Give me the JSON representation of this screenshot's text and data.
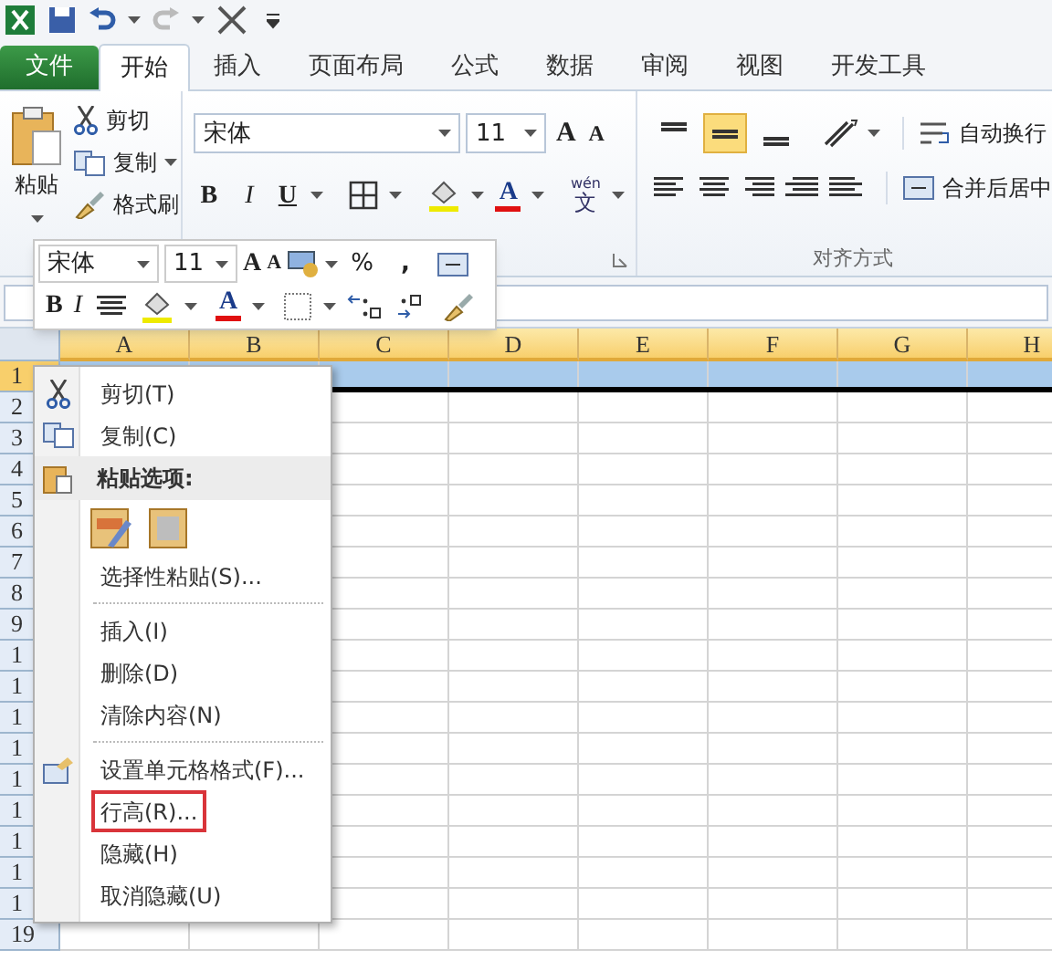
{
  "tabs": [
    {
      "label": "文件",
      "kind": "file",
      "selected": false
    },
    {
      "label": "开始",
      "kind": "tab",
      "selected": true
    },
    {
      "label": "插入",
      "kind": "tab",
      "selected": false
    },
    {
      "label": "页面布局",
      "kind": "tab",
      "selected": false
    },
    {
      "label": "公式",
      "kind": "tab",
      "selected": false
    },
    {
      "label": "数据",
      "kind": "tab",
      "selected": false
    },
    {
      "label": "审阅",
      "kind": "tab",
      "selected": false
    },
    {
      "label": "视图",
      "kind": "tab",
      "selected": false
    },
    {
      "label": "开发工具",
      "kind": "tab",
      "selected": false
    }
  ],
  "ribbon": {
    "clipboard": {
      "paste": "粘贴",
      "cut": "剪切",
      "copy": "复制",
      "format_painter": "格式刷"
    },
    "font": {
      "font_name": "宋体",
      "font_size": "11",
      "grow_font": "A",
      "shrink_font": "A",
      "bold": "B",
      "italic": "I",
      "underline": "U",
      "font_color": "A",
      "phonetic_top": "wén",
      "phonetic_bottom": "文"
    },
    "alignment": {
      "vertical_align": [
        {
          "selected": false
        },
        {
          "selected": true
        },
        {
          "selected": false
        }
      ],
      "wrap_text": "自动换行",
      "merge_center": "合并后居中",
      "group_label": "对齐方式"
    }
  },
  "mini_toolbar": {
    "font_name": "宋体",
    "font_size": "11",
    "grow_font": "A",
    "shrink_font": "A",
    "percent": "%",
    "comma": ",",
    "bold": "B",
    "italic": "I",
    "font_color": "A"
  },
  "sheet": {
    "columns": [
      "A",
      "B",
      "C",
      "D",
      "E",
      "F",
      "G",
      "H"
    ],
    "rows": [
      {
        "header": "1",
        "selected": true
      },
      {
        "header": "2",
        "selected": false
      },
      {
        "header": "3",
        "selected": false
      },
      {
        "header": "4",
        "selected": false
      },
      {
        "header": "5",
        "selected": false
      },
      {
        "header": "6",
        "selected": false
      },
      {
        "header": "7",
        "selected": false
      },
      {
        "header": "8",
        "selected": false
      },
      {
        "header": "9",
        "selected": false
      },
      {
        "header": "1",
        "selected": false
      },
      {
        "header": "1",
        "selected": false
      },
      {
        "header": "1",
        "selected": false
      },
      {
        "header": "1",
        "selected": false
      },
      {
        "header": "1",
        "selected": false
      },
      {
        "header": "1",
        "selected": false
      },
      {
        "header": "1",
        "selected": false
      },
      {
        "header": "1",
        "selected": false
      },
      {
        "header": "1",
        "selected": false
      },
      {
        "header": "19",
        "selected": false
      }
    ]
  },
  "context_menu": [
    {
      "kind": "command",
      "label": "剪切(T)",
      "highlighted": false
    },
    {
      "kind": "command",
      "label": "复制(C)",
      "highlighted": false
    },
    {
      "kind": "header",
      "label": "粘贴选项:"
    },
    {
      "kind": "paste_options"
    },
    {
      "kind": "command",
      "label": "选择性粘贴(S)...",
      "highlighted": false
    },
    {
      "kind": "separator"
    },
    {
      "kind": "command",
      "label": "插入(I)",
      "highlighted": false
    },
    {
      "kind": "command",
      "label": "删除(D)",
      "highlighted": false
    },
    {
      "kind": "command",
      "label": "清除内容(N)",
      "highlighted": false
    },
    {
      "kind": "separator"
    },
    {
      "kind": "command",
      "label": "设置单元格格式(F)...",
      "highlighted": false
    },
    {
      "kind": "command",
      "label": "行高(R)...",
      "highlighted": true
    },
    {
      "kind": "command",
      "label": "隐藏(H)",
      "highlighted": false
    },
    {
      "kind": "command",
      "label": "取消隐藏(U)",
      "highlighted": false
    }
  ]
}
